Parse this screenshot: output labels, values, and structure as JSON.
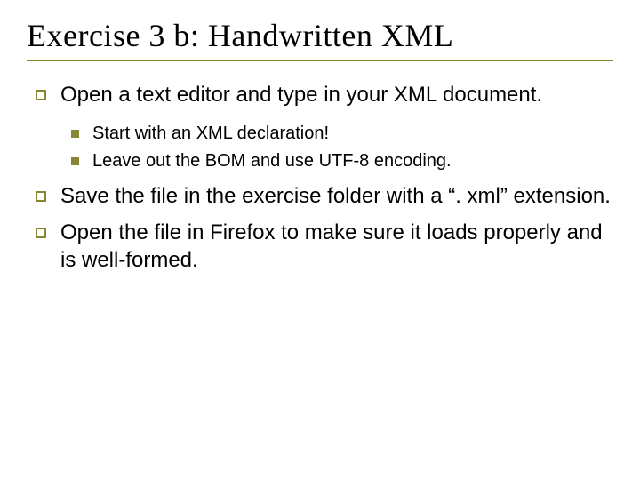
{
  "title": "Exercise 3 b: Handwritten XML",
  "items": [
    {
      "text": "Open a text editor and type in your XML document.",
      "sub": [
        {
          "text": "Start with an XML declaration!"
        },
        {
          "text": "Leave out the BOM and use UTF-8 encoding."
        }
      ]
    },
    {
      "text": "Save the file in the exercise folder with a “. xml” extension.",
      "sub": []
    },
    {
      "text": "Open the file in Firefox to make sure it loads properly and is well-formed.",
      "sub": []
    }
  ]
}
